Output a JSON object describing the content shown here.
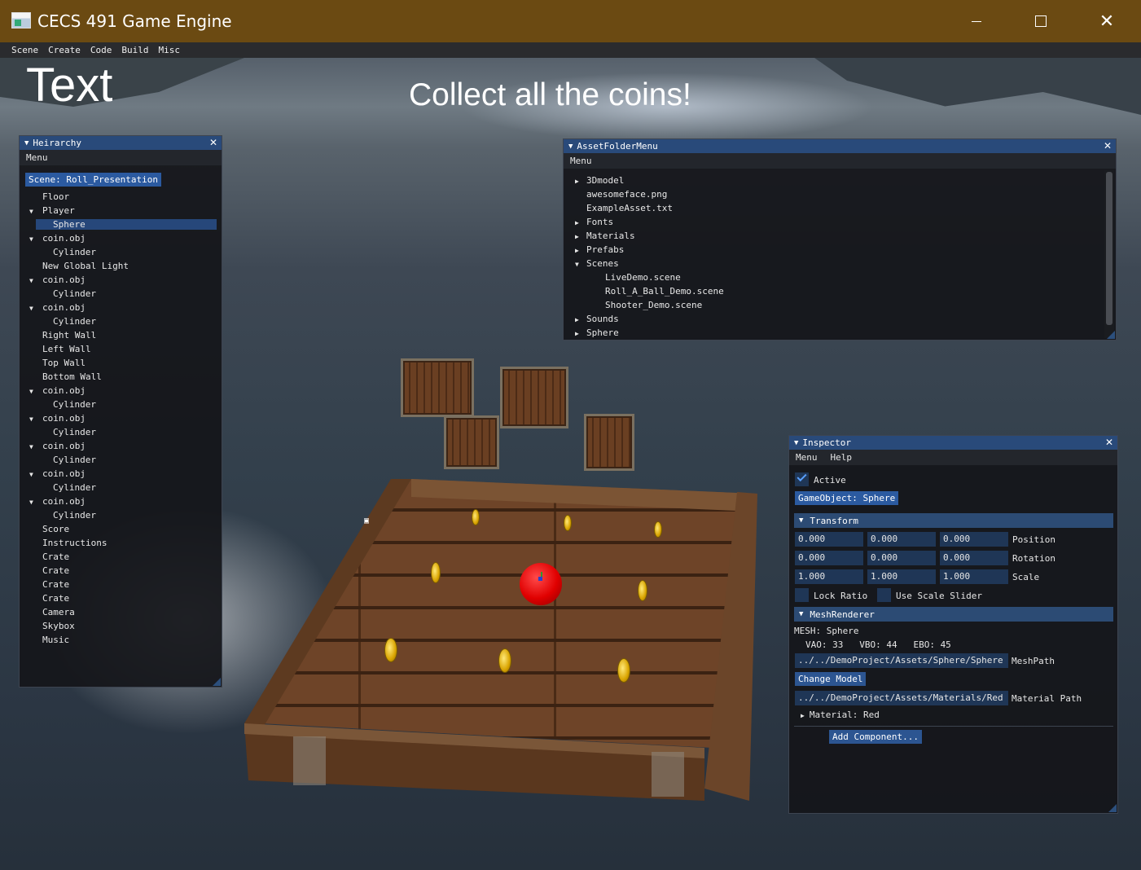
{
  "window": {
    "title": "CECS 491 Game Engine"
  },
  "menubar": [
    "Scene",
    "Create",
    "Code",
    "Build",
    "Misc"
  ],
  "scene": {
    "big_text": "Text",
    "objective": "Collect all the coins!"
  },
  "hierarchy": {
    "title": "Heirarchy",
    "menu": "Menu",
    "scene_button": "Scene: Roll_Presentation",
    "items": [
      {
        "label": "Floor",
        "depth": 1,
        "arrow": false
      },
      {
        "label": "Player",
        "depth": 1,
        "arrow": true
      },
      {
        "label": "Sphere",
        "depth": 2,
        "arrow": false,
        "selected": true
      },
      {
        "label": "coin.obj",
        "depth": 1,
        "arrow": true
      },
      {
        "label": "Cylinder",
        "depth": 2,
        "arrow": false
      },
      {
        "label": "New Global Light",
        "depth": 1,
        "arrow": false
      },
      {
        "label": "coin.obj",
        "depth": 1,
        "arrow": true
      },
      {
        "label": "Cylinder",
        "depth": 2,
        "arrow": false
      },
      {
        "label": "coin.obj",
        "depth": 1,
        "arrow": true
      },
      {
        "label": "Cylinder",
        "depth": 2,
        "arrow": false
      },
      {
        "label": "Right Wall",
        "depth": 1,
        "arrow": false
      },
      {
        "label": "Left Wall",
        "depth": 1,
        "arrow": false
      },
      {
        "label": "Top Wall",
        "depth": 1,
        "arrow": false
      },
      {
        "label": "Bottom Wall",
        "depth": 1,
        "arrow": false
      },
      {
        "label": "coin.obj",
        "depth": 1,
        "arrow": true
      },
      {
        "label": "Cylinder",
        "depth": 2,
        "arrow": false
      },
      {
        "label": "coin.obj",
        "depth": 1,
        "arrow": true
      },
      {
        "label": "Cylinder",
        "depth": 2,
        "arrow": false
      },
      {
        "label": "coin.obj",
        "depth": 1,
        "arrow": true
      },
      {
        "label": "Cylinder",
        "depth": 2,
        "arrow": false
      },
      {
        "label": "coin.obj",
        "depth": 1,
        "arrow": true
      },
      {
        "label": "Cylinder",
        "depth": 2,
        "arrow": false
      },
      {
        "label": "coin.obj",
        "depth": 1,
        "arrow": true
      },
      {
        "label": "Cylinder",
        "depth": 2,
        "arrow": false
      },
      {
        "label": "Score",
        "depth": 1,
        "arrow": false
      },
      {
        "label": "Instructions",
        "depth": 1,
        "arrow": false
      },
      {
        "label": "Crate",
        "depth": 1,
        "arrow": false
      },
      {
        "label": "Crate",
        "depth": 1,
        "arrow": false
      },
      {
        "label": "Crate",
        "depth": 1,
        "arrow": false
      },
      {
        "label": "Crate",
        "depth": 1,
        "arrow": false
      },
      {
        "label": "Camera",
        "depth": 1,
        "arrow": false
      },
      {
        "label": "Skybox",
        "depth": 1,
        "arrow": false
      },
      {
        "label": "Music",
        "depth": 1,
        "arrow": false
      }
    ]
  },
  "assets": {
    "title": "AssetFolderMenu",
    "menu": "Menu",
    "items": [
      {
        "label": "3Dmodel",
        "depth": 0,
        "arrow": "right"
      },
      {
        "label": "awesomeface.png",
        "depth": 0,
        "arrow": "none"
      },
      {
        "label": "ExampleAsset.txt",
        "depth": 0,
        "arrow": "none"
      },
      {
        "label": "Fonts",
        "depth": 0,
        "arrow": "right"
      },
      {
        "label": "Materials",
        "depth": 0,
        "arrow": "right"
      },
      {
        "label": "Prefabs",
        "depth": 0,
        "arrow": "right"
      },
      {
        "label": "Scenes",
        "depth": 0,
        "arrow": "down"
      },
      {
        "label": "LiveDemo.scene",
        "depth": 1,
        "arrow": "none"
      },
      {
        "label": "Roll_A_Ball_Demo.scene",
        "depth": 1,
        "arrow": "none"
      },
      {
        "label": "Shooter_Demo.scene",
        "depth": 1,
        "arrow": "none"
      },
      {
        "label": "Sounds",
        "depth": 0,
        "arrow": "right"
      },
      {
        "label": "Sphere",
        "depth": 0,
        "arrow": "right"
      }
    ]
  },
  "inspector": {
    "title": "Inspector",
    "menu": [
      "Menu",
      "Help"
    ],
    "active_label": "Active",
    "active": true,
    "gameobject_button": "GameObject: Sphere",
    "transform_header": "Transform",
    "position": [
      "0.000",
      "0.000",
      "0.000"
    ],
    "rotation": [
      "0.000",
      "0.000",
      "0.000"
    ],
    "scale": [
      "1.000",
      "1.000",
      "1.000"
    ],
    "position_label": "Position",
    "rotation_label": "Rotation",
    "scale_label": "Scale",
    "lock_ratio_label": "Lock Ratio",
    "use_scale_slider_label": "Use Scale Slider",
    "meshrenderer_header": "MeshRenderer",
    "mesh_line": "MESH: Sphere",
    "vao_line": "VAO: 33   VBO: 44   EBO: 45",
    "mesh_path_value": "../../DemoProject/Assets/Sphere/Sphere",
    "mesh_path_label": "MeshPath",
    "change_model_button": "Change Model",
    "material_path_value": "../../DemoProject/Assets/Materials/Red",
    "material_path_label": "Material Path",
    "material_label": "Material: Red",
    "add_component_button": "Add Component..."
  },
  "colors": {
    "titlebar": "#6b4a12",
    "panel_title": "#294a7a",
    "selection": "#2b5aa0",
    "field_bg": "#1f3656"
  }
}
